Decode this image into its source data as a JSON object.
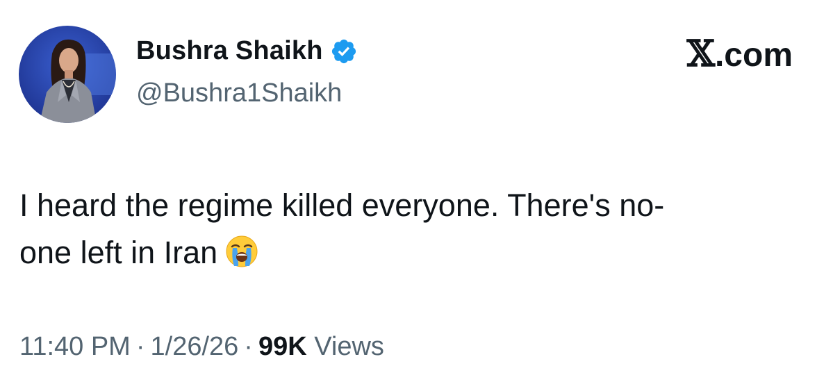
{
  "author": {
    "display_name": "Bushra Shaikh",
    "handle": "@Bushra1Shaikh",
    "verified": true,
    "verified_color": "#1d9bf0"
  },
  "brand": {
    "x_glyph": "𝕏",
    "suffix": ".com"
  },
  "tweet": {
    "line1": "I heard the regime killed everyone. There's no-",
    "line2": "one left in Iran",
    "emoji_icon": "loudly-crying-face-emoji"
  },
  "meta": {
    "time": "11:40 PM",
    "separator": "·",
    "date": "1/26/26",
    "views_count": "99K",
    "views_label": "Views"
  },
  "colors": {
    "text_primary": "#0f1419",
    "text_secondary": "#536471",
    "background": "#ffffff"
  }
}
